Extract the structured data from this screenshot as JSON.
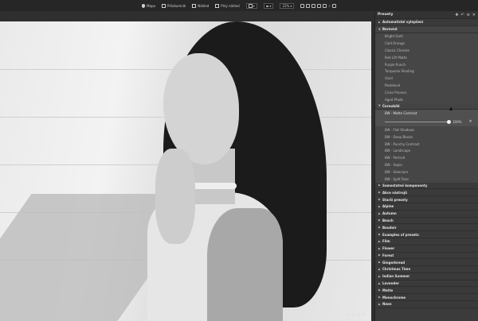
{
  "toolbar": {
    "map_label": "Mapa",
    "browser_label": "Průzkumník",
    "view_label": "Náhled",
    "fullscreen_label": "Plný náhled",
    "zoom_value": "22%"
  },
  "viewer": {
    "rating_stars": "★★★★"
  },
  "panel": {
    "title": "Presety"
  },
  "presets": {
    "categories_top": [
      {
        "label": "Automatické vylepšení",
        "open": false
      },
      {
        "label": "Barevné",
        "open": true
      }
    ],
    "color_items": [
      "Bright Gold",
      "Cold Orange",
      "Classic Chrome",
      "Red Lift Matte",
      "Purple Punch",
      "Turquoise Shading",
      "Vivid",
      "Pastelové",
      "Cross Process",
      "Aged Photo"
    ],
    "bw_category": "Černobílé",
    "bw_active_item": "BW - Matte Contrast",
    "slider_value": "100%",
    "slider_fraction": 0.98,
    "bw_items": [
      "BW - Flat Shadows",
      "BW - Deep Blacks",
      "BW - Punchy Contrast",
      "BW - Landscape",
      "BW - Portrait",
      "BW - Sepia",
      "BW - Selenium",
      "BW - Split Tone"
    ],
    "categories_bottom": [
      "Samostatné komponenty",
      "Akce nástrojů",
      "Starší presety",
      "Alpine",
      "Autumn",
      "Beach",
      "Boudoir",
      "Examples of presets",
      "Film",
      "Flower",
      "Forest",
      "Gingerbread",
      "Christmas Time",
      "Indian Summer",
      "Lavender",
      "Matte",
      "Monochrome",
      "Neon"
    ]
  },
  "colors": {
    "panel_bg": "#3b3b3b",
    "toolbar_bg": "#262626",
    "active_item_bg": "#505050"
  }
}
